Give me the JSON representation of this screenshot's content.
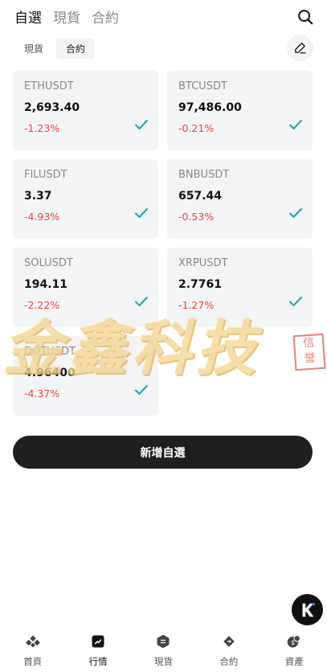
{
  "header": {
    "tabs": [
      {
        "label": "自選",
        "active": true
      },
      {
        "label": "現貨",
        "active": false
      },
      {
        "label": "合約",
        "active": false
      }
    ],
    "search_icon": "search-icon"
  },
  "sub_tabs": [
    {
      "label": "現貨",
      "active": false
    },
    {
      "label": "合約",
      "active": true
    }
  ],
  "edit_icon": "pencil-icon",
  "watchlist": [
    {
      "symbol": "ETHUSDT",
      "price": "2,693.40",
      "change": "-1.23%"
    },
    {
      "symbol": "BTCUSDT",
      "price": "97,486.00",
      "change": "-0.21%"
    },
    {
      "symbol": "FILUSDT",
      "price": "3.37",
      "change": "-4.93%"
    },
    {
      "symbol": "BNBUSDT",
      "price": "657.44",
      "change": "-0.53%"
    },
    {
      "symbol": "SOLUSDT",
      "price": "194.11",
      "change": "-2.22%"
    },
    {
      "symbol": "XRPUSDT",
      "price": "2.7761",
      "change": "-1.27%"
    },
    {
      "symbol": "DOTUSDT",
      "price": "4.96400",
      "change": "-4.37%"
    }
  ],
  "add_button_label": "新增自選",
  "watermark": {
    "text": "金鑫科技",
    "seal": "信誉"
  },
  "bottom_nav": [
    {
      "label": "首頁",
      "icon": "home-icon",
      "active": false
    },
    {
      "label": "行情",
      "icon": "market-icon",
      "active": true
    },
    {
      "label": "現貨",
      "icon": "spot-icon",
      "active": false
    },
    {
      "label": "合約",
      "icon": "contract-icon",
      "active": false
    },
    {
      "label": "資產",
      "icon": "assets-icon",
      "active": false
    }
  ],
  "colors": {
    "negative": "#e94343",
    "check": "#1ba5a5",
    "button": "#1f1f1f"
  }
}
